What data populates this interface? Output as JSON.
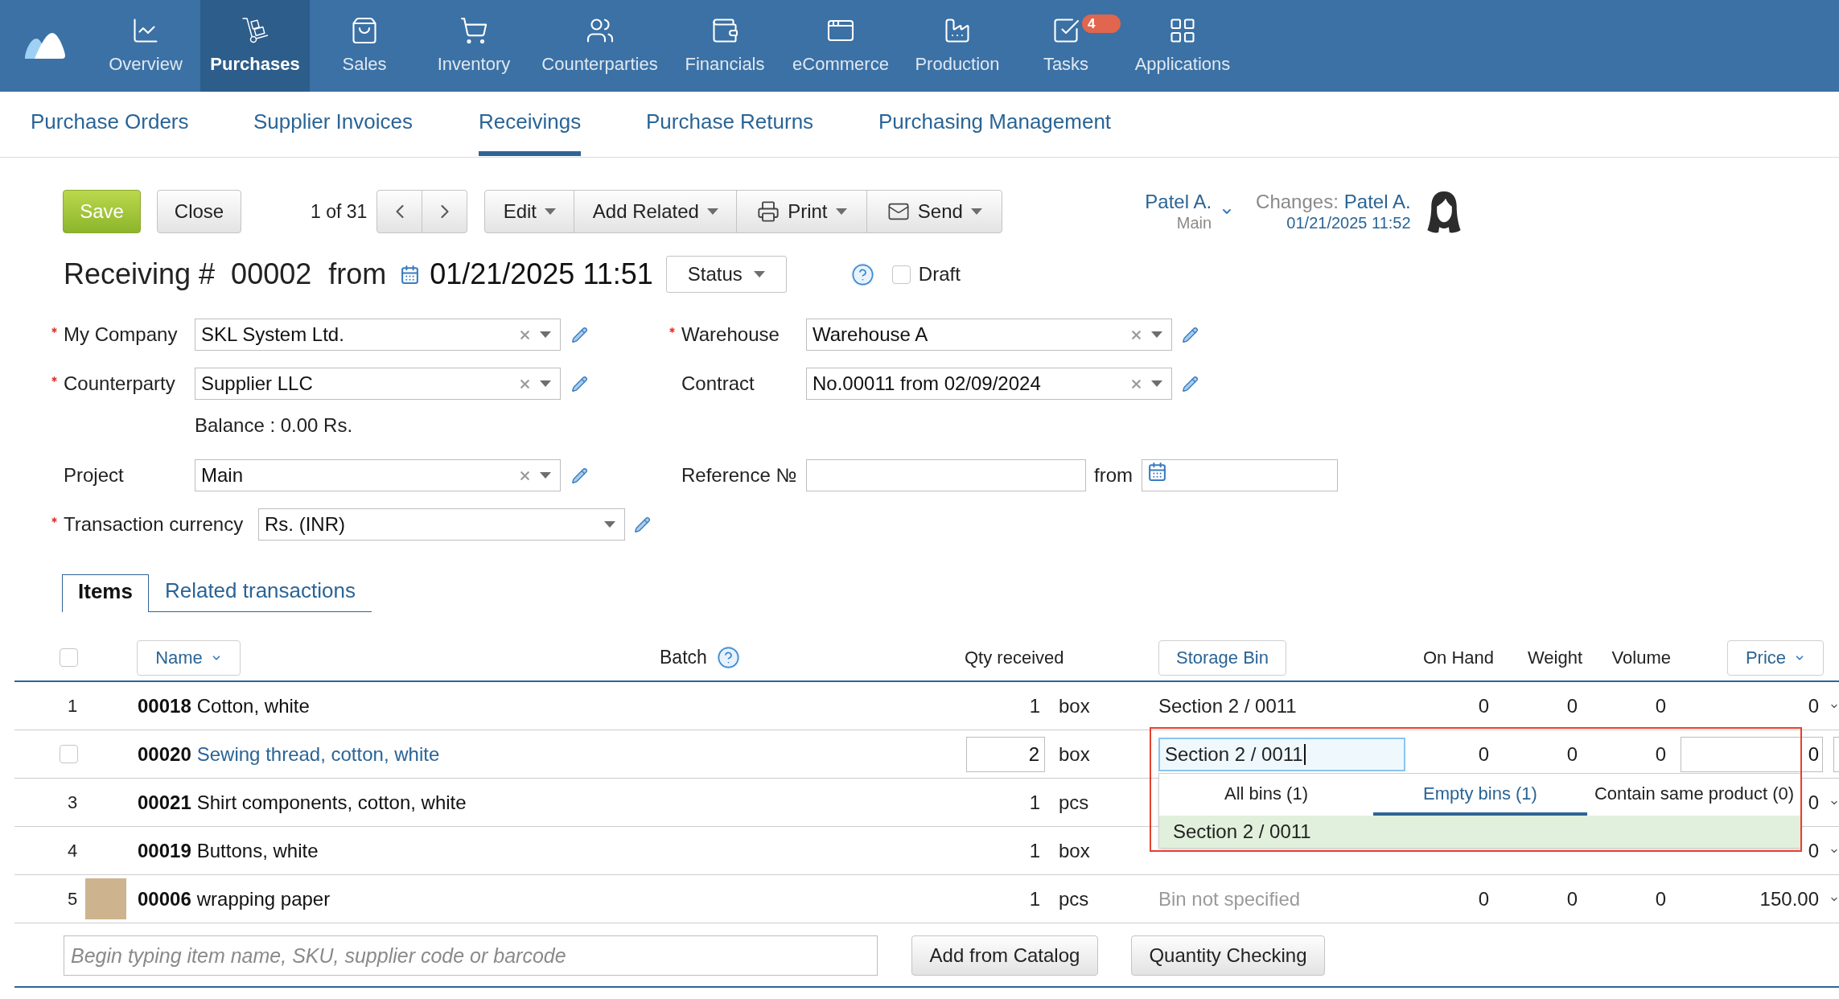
{
  "nav": {
    "items": [
      {
        "label": "Overview",
        "selected": false
      },
      {
        "label": "Purchases",
        "selected": true
      },
      {
        "label": "Sales",
        "selected": false
      },
      {
        "label": "Inventory",
        "selected": false
      },
      {
        "label": "Counterparties",
        "selected": false
      },
      {
        "label": "Financials",
        "selected": false
      },
      {
        "label": "eCommerce",
        "selected": false
      },
      {
        "label": "Production",
        "selected": false
      },
      {
        "label": "Tasks",
        "selected": false,
        "badge": "4"
      },
      {
        "label": "Applications",
        "selected": false
      }
    ]
  },
  "subnav": {
    "items": [
      {
        "label": "Purchase Orders",
        "selected": false
      },
      {
        "label": "Supplier Invoices",
        "selected": false
      },
      {
        "label": "Receivings",
        "selected": true
      },
      {
        "label": "Purchase Returns",
        "selected": false
      },
      {
        "label": "Purchasing Management",
        "selected": false
      }
    ]
  },
  "toolbar": {
    "save": "Save",
    "close": "Close",
    "pager": "1 of 31",
    "menus": [
      "Edit",
      "Add Related",
      "Print",
      "Send"
    ]
  },
  "user": {
    "name": "Patel A.",
    "branch": "Main"
  },
  "changes": {
    "label": "Changes:",
    "name": "Patel A.",
    "time": "01/21/2025 11:52"
  },
  "title": {
    "label": "Receiving #",
    "number": "00002",
    "from": "from",
    "datetime": "01/21/2025 11:51",
    "status": "Status"
  },
  "draft": {
    "label": "Draft",
    "checked": false
  },
  "form": {
    "my_company": {
      "label": "My Company",
      "required": true,
      "value": "SKL System Ltd.",
      "clearable": true
    },
    "warehouse": {
      "label": "Warehouse",
      "required": true,
      "value": "Warehouse A",
      "clearable": true
    },
    "counterparty": {
      "label": "Counterparty",
      "required": true,
      "value": "Supplier LLC",
      "clearable": true
    },
    "contract": {
      "label": "Contract",
      "required": false,
      "value": "No.00011 from 02/09/2024",
      "clearable": true
    },
    "balance": "Balance : 0.00 Rs.",
    "project": {
      "label": "Project",
      "required": false,
      "value": "Main",
      "clearable": true
    },
    "reference": {
      "label": "Reference №",
      "required": false,
      "from": "from"
    },
    "currency": {
      "label": "Transaction currency",
      "required": true,
      "value": "Rs. (INR)",
      "clearable": false
    }
  },
  "tabs": [
    {
      "label": "Items",
      "selected": true
    },
    {
      "label": "Related transactions",
      "selected": false
    }
  ],
  "table": {
    "select_all": {
      "checked": false
    },
    "columns": [
      {
        "label": "Name",
        "kind": "sort"
      },
      {
        "label": "Batch",
        "kind": "help"
      },
      {
        "label": "Qty received",
        "kind": "plain"
      },
      {
        "label": "Storage Bin",
        "kind": "button"
      },
      {
        "label": "On Hand",
        "kind": "plain"
      },
      {
        "label": "Weight",
        "kind": "plain"
      },
      {
        "label": "Volume",
        "kind": "plain"
      },
      {
        "label": "Price",
        "kind": "sort"
      }
    ],
    "rows": [
      {
        "kind": "plain",
        "number": "1",
        "code": "00018",
        "name": "Cotton, white",
        "qty": "1",
        "unit": "box",
        "storage_bin": {
          "text": "Section 2 / 0011",
          "assigned": true
        },
        "on_hand": "0",
        "weight": "0",
        "volume": "0",
        "price": "0"
      },
      {
        "kind": "editing",
        "checked": false,
        "code": "00020",
        "name": "Sewing thread, cotton, white",
        "qty": "2",
        "unit": "box",
        "storage_bin": {
          "text": "Section 2 / 0011",
          "assigned": true
        },
        "on_hand": "0",
        "weight": "0",
        "volume": "0",
        "price": "0"
      },
      {
        "kind": "plain",
        "number": "3",
        "code": "00021",
        "name": "Shirt components, cotton, white",
        "qty": "1",
        "unit": "pcs",
        "price": "0"
      },
      {
        "kind": "plain",
        "number": "4",
        "code": "00019",
        "name": "Buttons, white",
        "qty": "1",
        "unit": "box",
        "price": "0"
      },
      {
        "kind": "plain",
        "number": "5",
        "photo": true,
        "code": "00006",
        "name": "wrapping paper",
        "qty": "1",
        "unit": "pcs",
        "storage_bin": {
          "text": "Bin not specified",
          "assigned": false
        },
        "on_hand": "0",
        "weight": "0",
        "volume": "0",
        "price": "150.00"
      }
    ]
  },
  "bin_dropdown": {
    "tabs": [
      {
        "label": "All bins (1)",
        "selected": false
      },
      {
        "label": "Empty bins (1)",
        "selected": true
      },
      {
        "label": "Contain same product (0)",
        "selected": false
      }
    ],
    "options": [
      {
        "label": "Section 2 / 0011",
        "highlighted": true
      }
    ]
  },
  "add_item": {
    "placeholder": "Begin typing item name, SKU, supplier code or barcode"
  },
  "actions": [
    "Add from Catalog",
    "Quantity Checking"
  ]
}
